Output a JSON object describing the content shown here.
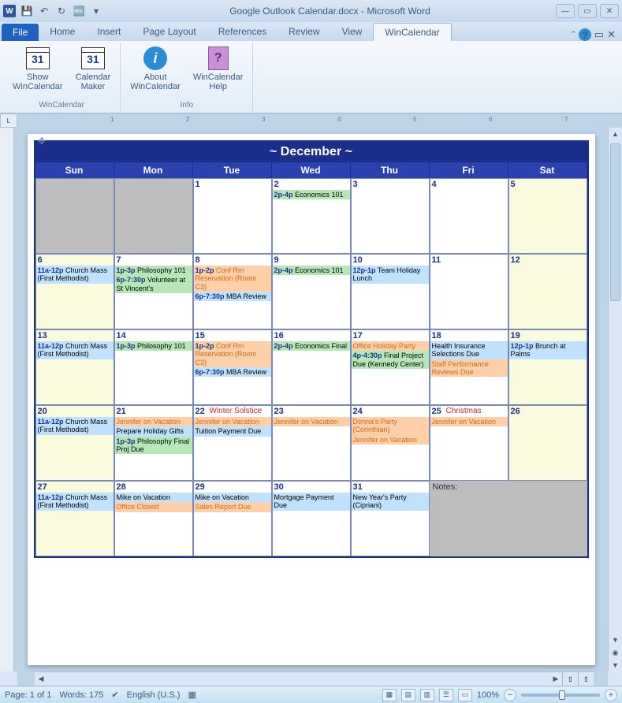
{
  "window": {
    "title": "Google Outlook Calendar.docx - Microsoft Word"
  },
  "qat": {
    "save": "💾",
    "undo": "↶",
    "redo": "↻",
    "lang": "🔤"
  },
  "tabs": {
    "file": "File",
    "items": [
      "Home",
      "Insert",
      "Page Layout",
      "References",
      "Review",
      "View",
      "WinCalendar"
    ],
    "active": "WinCalendar"
  },
  "ribbon": {
    "groups": [
      {
        "label": "WinCalendar",
        "buttons": [
          {
            "key": "show",
            "l1": "Show",
            "l2": "WinCalendar",
            "icon": "cal",
            "num": "31"
          },
          {
            "key": "maker",
            "l1": "Calendar",
            "l2": "Maker",
            "icon": "cal",
            "num": "31"
          }
        ]
      },
      {
        "label": "Info",
        "buttons": [
          {
            "key": "about",
            "l1": "About",
            "l2": "WinCalendar",
            "icon": "info"
          },
          {
            "key": "help",
            "l1": "WinCalendar",
            "l2": "Help",
            "icon": "help"
          }
        ]
      }
    ]
  },
  "calendar": {
    "title": "~ December ~",
    "days": [
      "Sun",
      "Mon",
      "Tue",
      "Wed",
      "Thu",
      "Fri",
      "Sat"
    ],
    "notes_label": "Notes:",
    "cells": [
      {
        "grey": true
      },
      {
        "grey": true
      },
      {
        "n": "1"
      },
      {
        "n": "2",
        "e": [
          {
            "c": "c-green",
            "t": "2p-4p",
            "x": "Economics 101"
          }
        ]
      },
      {
        "n": "3"
      },
      {
        "n": "4"
      },
      {
        "n": "5",
        "yellow": true
      },
      {
        "n": "6",
        "yellow": true,
        "e": [
          {
            "c": "c-blue",
            "t": "11a-12p",
            "x": "Church Mass (First Methodist)"
          }
        ]
      },
      {
        "n": "7",
        "e": [
          {
            "c": "c-green",
            "t": "1p-3p",
            "x": "Philosophy 101"
          },
          {
            "c": "c-green",
            "t": "6p-7:30p",
            "x": "Volunteer at St Vincent's"
          }
        ]
      },
      {
        "n": "8",
        "e": [
          {
            "c": "c-orange c-orangetxt",
            "t": "1p-2p",
            "x": "Conf Rm Reservation (Room C3)"
          },
          {
            "c": "c-blue",
            "t": "6p-7:30p",
            "x": "MBA Review"
          }
        ]
      },
      {
        "n": "9",
        "e": [
          {
            "c": "c-green",
            "t": "2p-4p",
            "x": "Economics 101"
          }
        ]
      },
      {
        "n": "10",
        "e": [
          {
            "c": "c-blue",
            "t": "12p-1p",
            "x": "Team Holiday Lunch"
          }
        ]
      },
      {
        "n": "11"
      },
      {
        "n": "12",
        "yellow": true
      },
      {
        "n": "13",
        "yellow": true,
        "e": [
          {
            "c": "c-blue",
            "t": "11a-12p",
            "x": "Church Mass (First Methodist)"
          }
        ]
      },
      {
        "n": "14",
        "e": [
          {
            "c": "c-green",
            "t": "1p-3p",
            "x": "Philosophy 101"
          }
        ]
      },
      {
        "n": "15",
        "e": [
          {
            "c": "c-orange c-orangetxt",
            "t": "1p-2p",
            "x": "Conf Rm Reservation (Room C3)"
          },
          {
            "c": "c-blue",
            "t": "6p-7:30p",
            "x": "MBA Review"
          }
        ]
      },
      {
        "n": "16",
        "e": [
          {
            "c": "c-green",
            "t": "2p-4p",
            "x": "Economics Final"
          }
        ]
      },
      {
        "n": "17",
        "e": [
          {
            "c": "c-orange c-orangetxt",
            "x": "Office Holiday Party"
          },
          {
            "c": "c-green",
            "t": "4p-4:30p",
            "x": "Final Project Due (Kennedy Center)"
          }
        ]
      },
      {
        "n": "18",
        "e": [
          {
            "c": "c-blue",
            "x": "Health Insurance Selections Due"
          },
          {
            "c": "c-orange c-orangetxt",
            "x": "Staff Performance Reviews Due"
          }
        ]
      },
      {
        "n": "19",
        "yellow": true,
        "e": [
          {
            "c": "c-blue",
            "t": "12p-1p",
            "x": "Brunch at Palms"
          }
        ]
      },
      {
        "n": "20",
        "yellow": true,
        "e": [
          {
            "c": "c-blue",
            "t": "11a-12p",
            "x": "Church Mass (First Methodist)"
          }
        ]
      },
      {
        "n": "21",
        "e": [
          {
            "c": "c-orange c-orangetxt",
            "x": "Jennifer on Vacation"
          },
          {
            "c": "c-blue",
            "x": "Prepare Holiday Gifts"
          },
          {
            "c": "c-green",
            "t": "1p-3p",
            "x": "Philosophy Final Proj Due"
          }
        ]
      },
      {
        "n": "22",
        "d": "Winter Solstice",
        "e": [
          {
            "c": "c-orange c-orangetxt",
            "x": "Jennifer on Vacation"
          },
          {
            "c": "c-blue",
            "x": "Tuition Payment Due"
          }
        ]
      },
      {
        "n": "23",
        "e": [
          {
            "c": "c-orange c-orangetxt",
            "x": "Jennifer on Vacation"
          }
        ]
      },
      {
        "n": "24",
        "e": [
          {
            "c": "c-orange c-orangetxt",
            "x": "Donna's Party (Corinthian)"
          },
          {
            "c": "c-orange c-orangetxt",
            "x": "Jennifer on Vacation"
          }
        ]
      },
      {
        "n": "25",
        "d": "Christmas",
        "e": [
          {
            "c": "c-orange c-orangetxt",
            "x": "Jennifer on Vacation"
          }
        ]
      },
      {
        "n": "26",
        "yellow": true
      },
      {
        "n": "27",
        "yellow": true,
        "e": [
          {
            "c": "c-blue",
            "t": "11a-12p",
            "x": "Church Mass (First Methodist)"
          }
        ]
      },
      {
        "n": "28",
        "e": [
          {
            "c": "c-blue",
            "x": "Mike on Vacation"
          },
          {
            "c": "c-orange c-orangetxt",
            "x": "Office Closed"
          }
        ]
      },
      {
        "n": "29",
        "e": [
          {
            "c": "c-blue",
            "x": "Mike on Vacation"
          },
          {
            "c": "c-orange c-orangetxt",
            "x": "Sales Report Due"
          }
        ]
      },
      {
        "n": "30",
        "e": [
          {
            "c": "c-blue",
            "x": "Mortgage Payment Due"
          }
        ]
      },
      {
        "n": "31",
        "e": [
          {
            "c": "c-blue",
            "x": "New Year's Party (Cipriani)"
          }
        ]
      }
    ]
  },
  "status": {
    "page": "Page: 1 of 1",
    "words": "Words: 175",
    "lang": "English (U.S.)",
    "zoom": "100%"
  }
}
